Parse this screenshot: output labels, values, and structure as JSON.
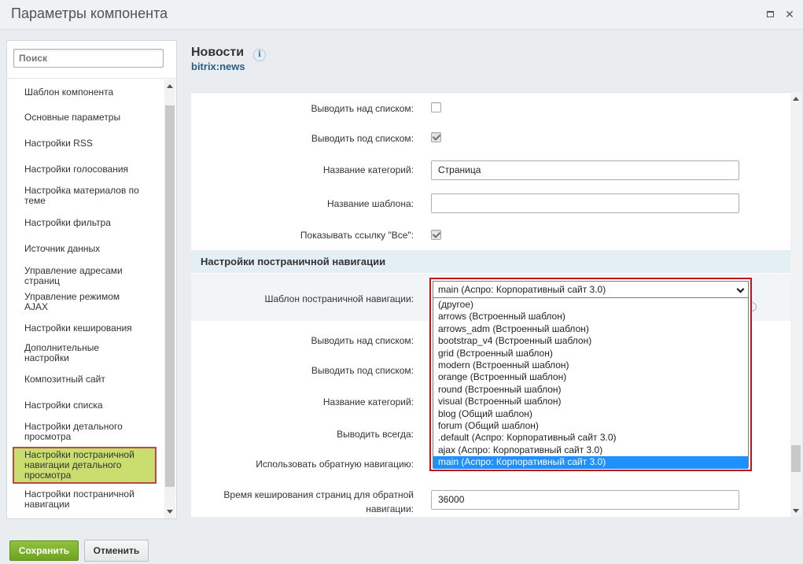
{
  "window": {
    "title": "Параметры компонента"
  },
  "sidebar": {
    "search_placeholder": "Поиск",
    "items": [
      {
        "label": "Шаблон компонента"
      },
      {
        "label": "Основные параметры"
      },
      {
        "label": "Настройки RSS"
      },
      {
        "label": "Настройки голосования"
      },
      {
        "label": "Настройка материалов по теме"
      },
      {
        "label": "Настройки фильтра"
      },
      {
        "label": "Источник данных"
      },
      {
        "label": "Управление адресами страниц"
      },
      {
        "label": "Управление режимом AJAX"
      },
      {
        "label": "Настройки кеширования"
      },
      {
        "label": "Дополнительные настройки"
      },
      {
        "label": "Композитный сайт"
      },
      {
        "label": "Настройки списка"
      },
      {
        "label": "Настройки детального просмотра"
      },
      {
        "label": "Настройки постраничной навигации детального просмотра",
        "active": true
      },
      {
        "label": "Настройки постраничной навигации"
      }
    ]
  },
  "header": {
    "title": "Новости",
    "subtitle": "bitrix:news"
  },
  "form": {
    "top_rows": [
      {
        "label": "Выводить над списком:",
        "type": "checkbox",
        "checked": false
      },
      {
        "label": "Выводить под списком:",
        "type": "checkbox",
        "checked": true
      },
      {
        "label": "Название категорий:",
        "type": "text",
        "value": "Страница"
      },
      {
        "label": "Название шаблона:",
        "type": "text",
        "value": ""
      },
      {
        "label": "Показывать ссылку \"Все\":",
        "type": "checkbox",
        "checked": true
      }
    ],
    "section_title": "Настройки постраничной навигации",
    "pager_template_label": "Шаблон постраничной навигации:",
    "lower_labels": [
      "Выводить над списком:",
      "Выводить под списком:",
      "Название категорий:",
      "Выводить всегда:",
      "Использовать обратную навигацию:"
    ],
    "cache_label_line1": "Время кеширования страниц для обратной",
    "cache_label_line2": "навигации:",
    "cache_value": "36000"
  },
  "dropdown": {
    "selected": "main (Аспро: Корпоративный сайт 3.0)",
    "options": [
      "(другое)",
      "arrows (Встроенный шаблон)",
      "arrows_adm (Встроенный шаблон)",
      "bootstrap_v4 (Встроенный шаблон)",
      "grid (Встроенный шаблон)",
      "modern (Встроенный шаблон)",
      "orange (Встроенный шаблон)",
      "round (Встроенный шаблон)",
      "visual (Встроенный шаблон)",
      "blog (Общий шаблон)",
      "forum (Общий шаблон)",
      ".default (Аспро: Корпоративный сайт 3.0)",
      "ajax (Аспро: Корпоративный сайт 3.0)",
      "main (Аспро: Корпоративный сайт 3.0)"
    ],
    "selected_index": 13
  },
  "footer": {
    "save_label": "Сохранить",
    "cancel_label": "Отменить"
  },
  "colors": {
    "save_green": "#7ab12c",
    "highlight_border": "#c0141a",
    "active_item_bg": "#c9de6f",
    "selected_option": "#1e90ff",
    "section_bg": "#e4eef5"
  }
}
